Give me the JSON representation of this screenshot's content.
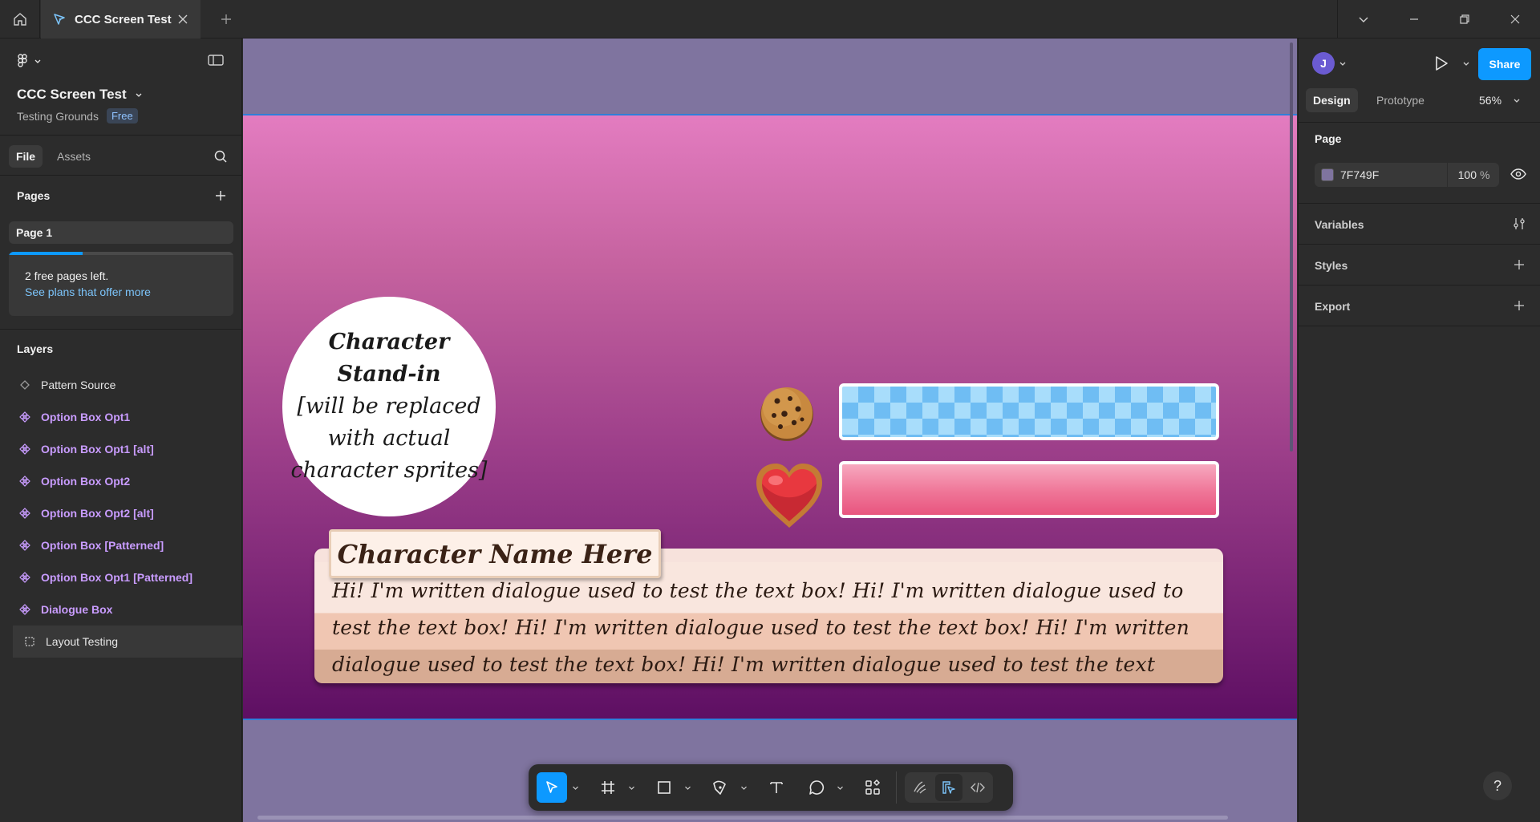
{
  "titlebar": {
    "tab_title": "CCC Screen Test"
  },
  "left_panel": {
    "file_name": "CCC Screen Test",
    "project": "Testing Grounds",
    "plan": "Free",
    "tabs": {
      "file": "File",
      "assets": "Assets"
    },
    "pages_title": "Pages",
    "pages": [
      {
        "label": "Page 1"
      }
    ],
    "page_limit": {
      "text": "2 free pages left.",
      "link": "See plans that offer more",
      "used_fraction": 0.33
    },
    "layers_title": "Layers",
    "layers": [
      {
        "label": "Pattern Source",
        "kind": "diamond-icon"
      },
      {
        "label": "Option Box Opt1",
        "kind": "component-icon"
      },
      {
        "label": "Option Box Opt1 [alt]",
        "kind": "component-icon"
      },
      {
        "label": "Option Box Opt2",
        "kind": "component-icon"
      },
      {
        "label": "Option Box Opt2 [alt]",
        "kind": "component-icon"
      },
      {
        "label": "Option Box [Patterned]",
        "kind": "component-icon"
      },
      {
        "label": "Option Box Opt1 [Patterned]",
        "kind": "component-icon"
      },
      {
        "label": "Dialogue Box",
        "kind": "component-icon"
      },
      {
        "label": "Layout Testing",
        "kind": "frame-icon"
      }
    ]
  },
  "canvas": {
    "background": "#7F749F",
    "stand_in": {
      "line1": "Character",
      "line2": "Stand-in",
      "line3": "[will be replaced",
      "line4": "with actual",
      "line5": "character sprites]"
    },
    "character_name": "Character Name Here",
    "dialogue": "Hi! I'm written dialogue used to test the text box! Hi! I'm written dialogue used to test the text box! Hi! I'm written dialogue used to test the text box! Hi! I'm written dialogue used to test the text box! Hi! I'm written dialogue used to test the text box!"
  },
  "toolbar": {
    "tools": [
      "move-icon",
      "frame-icon",
      "rectangle-icon",
      "pen-icon",
      "text-icon",
      "comment-icon",
      "actions-icon"
    ],
    "modes": [
      "draw-mode-icon",
      "design-mode-icon",
      "dev-mode-icon"
    ]
  },
  "right_panel": {
    "avatar_initial": "J",
    "share": "Share",
    "tabs": {
      "design": "Design",
      "prototype": "Prototype"
    },
    "zoom": "56%",
    "page_title": "Page",
    "page_color": "7F749F",
    "page_color_hex": "#7F749F",
    "opacity": "100",
    "opacity_unit": "%",
    "sections": {
      "variables": "Variables",
      "styles": "Styles",
      "export": "Export"
    },
    "help": "?"
  },
  "colors": {
    "accent": "#0d99ff",
    "component": "#c99cff"
  }
}
